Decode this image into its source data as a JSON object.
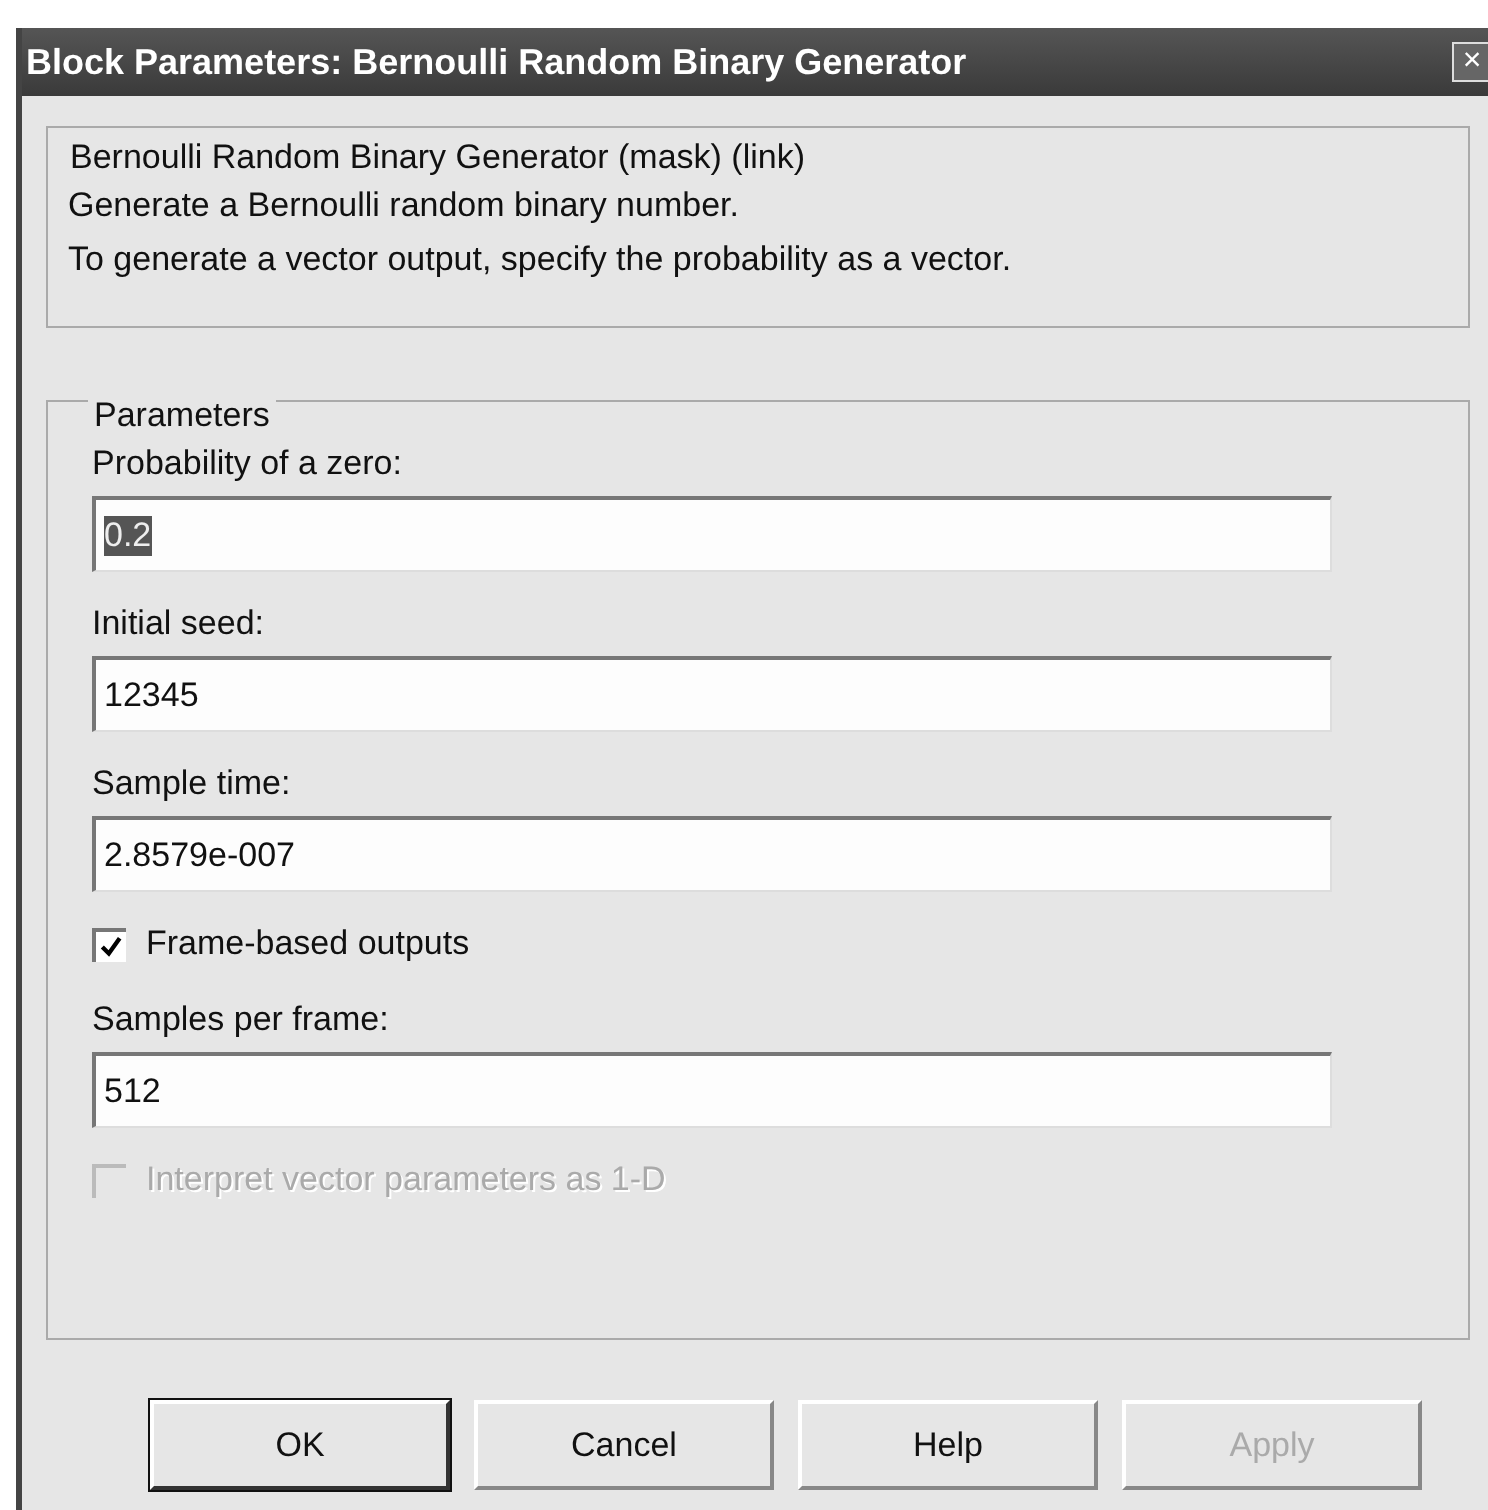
{
  "window": {
    "title": "Block Parameters: Bernoulli Random Binary Generator",
    "close_icon": "×"
  },
  "description_group": {
    "title": "Bernoulli Random Binary Generator (mask) (link)",
    "lines": [
      "Generate a Bernoulli random binary number.",
      "To generate a vector output, specify the probability as a vector."
    ]
  },
  "parameters": {
    "title": "Parameters",
    "items": [
      {
        "kind": "field",
        "label": "Probability of a zero:",
        "value": "0.2",
        "highlighted": true
      },
      {
        "kind": "field",
        "label": "Initial seed:",
        "value": "12345",
        "highlighted": false
      },
      {
        "kind": "field",
        "label": "Sample time:",
        "value": "2.8579e-007",
        "highlighted": false
      },
      {
        "kind": "checkbox",
        "label": "Frame-based outputs",
        "checked": true,
        "disabled": false
      },
      {
        "kind": "field",
        "label": "Samples per frame:",
        "value": "512",
        "highlighted": false
      },
      {
        "kind": "checkbox",
        "label": "Interpret vector parameters as 1-D",
        "checked": false,
        "disabled": true
      }
    ]
  },
  "buttons": [
    {
      "label": "OK",
      "default": true,
      "disabled": false
    },
    {
      "label": "Cancel",
      "default": false,
      "disabled": false
    },
    {
      "label": "Help",
      "default": false,
      "disabled": false
    },
    {
      "label": "Apply",
      "default": false,
      "disabled": true
    }
  ]
}
